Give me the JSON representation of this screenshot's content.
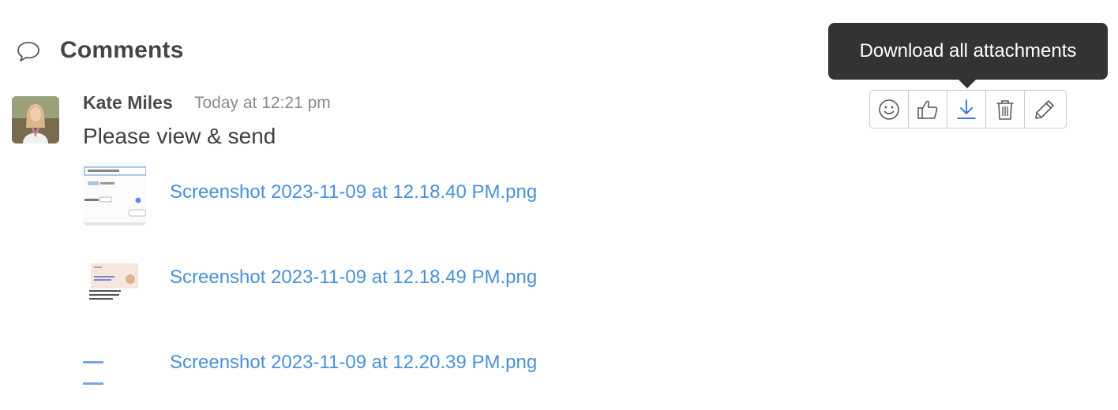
{
  "comments": {
    "title": "Comments",
    "icons": {
      "header": "speech-bubble-icon"
    }
  },
  "comment": {
    "author": "Kate Miles",
    "timestamp": "Today at 12:21 pm",
    "message": "Please view & send",
    "attachments": [
      {
        "name": "Screenshot 2023-11-09 at 12.18.40 PM.png"
      },
      {
        "name": "Screenshot 2023-11-09 at 12.18.49 PM.png"
      },
      {
        "name": "Screenshot 2023-11-09 at 12.20.39 PM.png"
      }
    ]
  },
  "toolbar": {
    "tooltip": "Download all attachments",
    "buttons": [
      "smiley-icon",
      "thumbs-up-icon",
      "download-icon",
      "trash-icon",
      "pencil-icon"
    ]
  },
  "colors": {
    "link": "#4a90d9",
    "tooltip_bg": "#333333",
    "download_accent": "#2d6fd1"
  }
}
